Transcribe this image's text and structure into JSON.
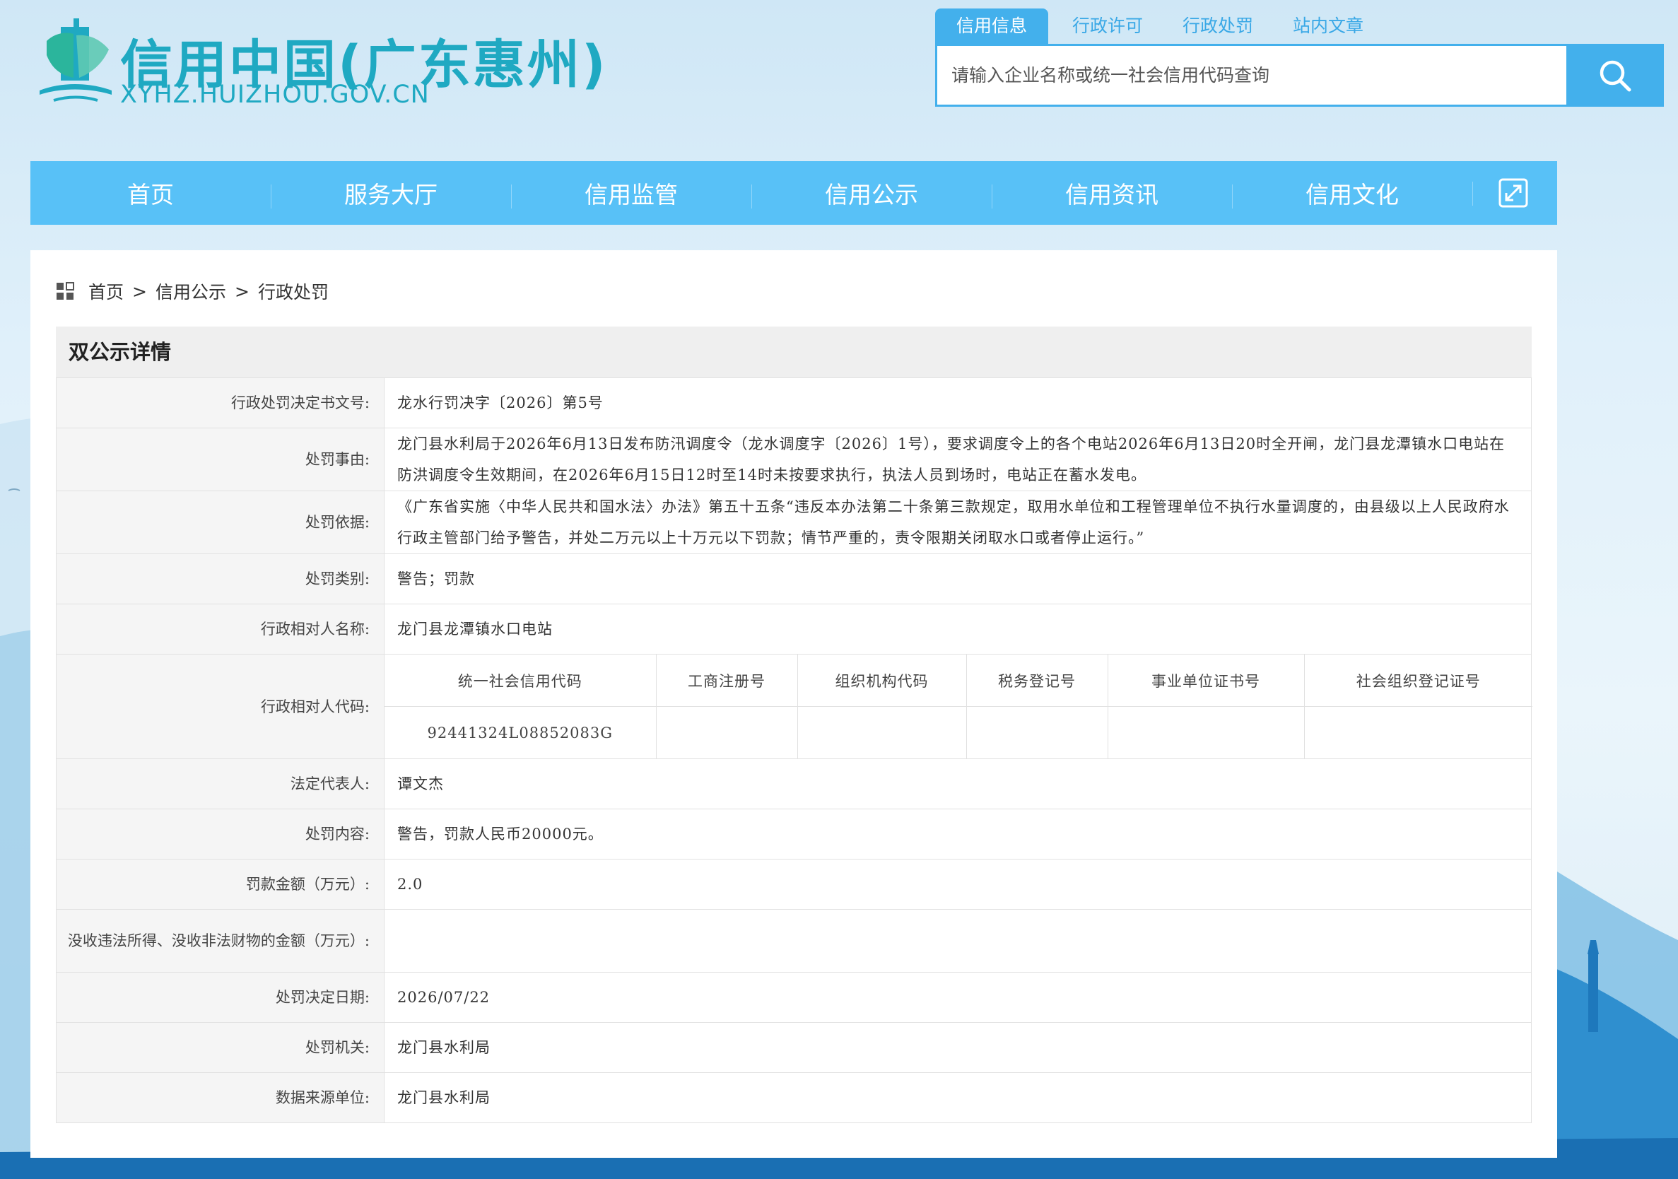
{
  "header": {
    "logo_title": "信用中国(广东惠州)",
    "logo_subtitle": "XYHZ.HUIZHOU.GOV.CN",
    "search_tabs": [
      "信用信息",
      "行政许可",
      "行政处罚",
      "站内文章"
    ],
    "active_tab": "信用信息",
    "search_placeholder": "请输入企业名称或统一社会信用代码查询"
  },
  "nav": {
    "items": [
      "首页",
      "服务大厅",
      "信用监管",
      "信用公示",
      "信用资讯",
      "信用文化"
    ],
    "expand_icon": "expand-icon"
  },
  "breadcrumb": {
    "items": [
      "首页",
      "信用公示",
      "行政处罚"
    ],
    "separator": ">"
  },
  "detail": {
    "title": "双公示详情",
    "rows": [
      {
        "label": "行政处罚决定书文号:",
        "value": "龙水行罚决字〔2026〕第5号"
      },
      {
        "label": "处罚事由:",
        "value": "龙门县水利局于2026年6月13日发布防汛调度令（龙水调度字〔2026〕1号），要求调度令上的各个电站2026年6月13日20时全开闸，龙门县龙潭镇水口电站在防洪调度令生效期间，在2026年6月15日12时至14时未按要求执行，执法人员到场时，电站正在蓄水发电。"
      },
      {
        "label": "处罚依据:",
        "value": "《广东省实施〈中华人民共和国水法〉办法》第五十五条“违反本办法第二十条第三款规定，取用水单位和工程管理单位不执行水量调度的，由县级以上人民政府水行政主管部门给予警告，并处二万元以上十万元以下罚款；情节严重的，责令限期关闭取水口或者停止运行。”"
      },
      {
        "label": "处罚类别:",
        "value": "警告；罚款"
      },
      {
        "label": "行政相对人名称:",
        "value": "龙门县龙潭镇水口电站"
      },
      {
        "label": "行政相对人代码:",
        "value": ""
      },
      {
        "label": "法定代表人:",
        "value": "谭文杰"
      },
      {
        "label": "处罚内容:",
        "value": "警告，罚款人民币20000元。"
      },
      {
        "label": "罚款金额（万元）:",
        "value": "2.0"
      },
      {
        "label": "没收违法所得、没收非法财物的金额（万元）:",
        "value": ""
      },
      {
        "label": "处罚决定日期:",
        "value": "2026/07/22"
      },
      {
        "label": "处罚机关:",
        "value": "龙门县水利局"
      },
      {
        "label": "数据来源单位:",
        "value": "龙门县水利局"
      }
    ],
    "code_headers": [
      "统一社会信用代码",
      "工商注册号",
      "组织机构代码",
      "税务登记号",
      "事业单位证书号",
      "社会组织登记证号"
    ],
    "code_values": [
      "92441324L08852083G",
      "",
      "",
      "",
      "",
      ""
    ]
  },
  "colors": {
    "accent": "#43b0ec",
    "nav_bg": "#58c1f7",
    "logo": "#1fa9c2"
  }
}
